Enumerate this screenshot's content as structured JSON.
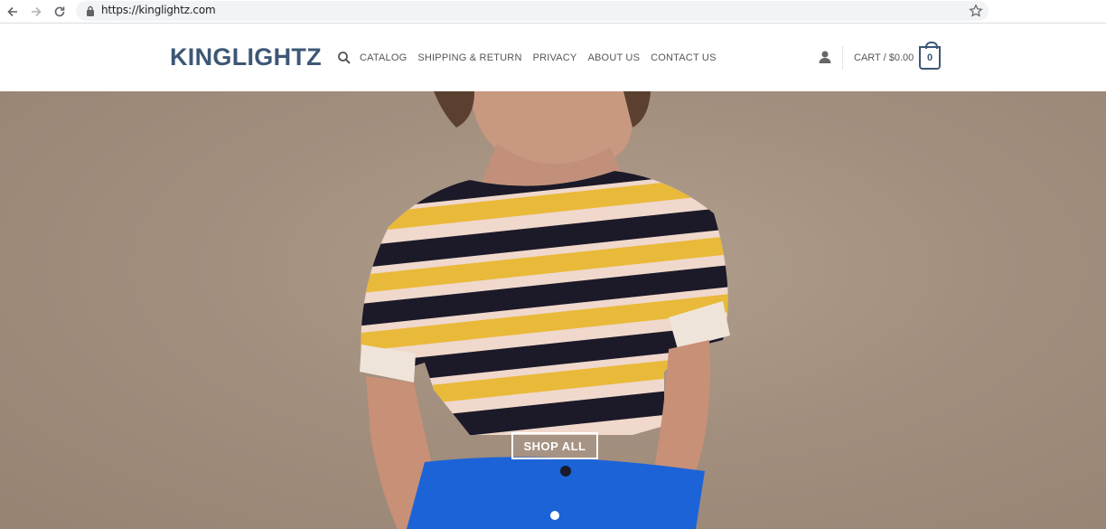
{
  "browser": {
    "url": "https://kinglightz.com"
  },
  "header": {
    "logo": "KINGLIGHTZ",
    "nav": [
      {
        "label": "CATALOG"
      },
      {
        "label": "SHIPPING & RETURN"
      },
      {
        "label": "PRIVACY"
      },
      {
        "label": "ABOUT US"
      },
      {
        "label": "CONTACT US"
      }
    ],
    "cart_label": "CART / $0.00",
    "cart_count": "0"
  },
  "hero": {
    "cta_label": "SHOP ALL",
    "slides_total": 1,
    "active_slide": 1
  },
  "colors": {
    "brand": "#3d5776",
    "hero_bg": "#a38f7e"
  },
  "icons": [
    "back-arrow-icon",
    "forward-arrow-icon",
    "reload-icon",
    "lock-icon",
    "star-icon",
    "search-icon",
    "user-icon",
    "shopping-bag-icon"
  ]
}
